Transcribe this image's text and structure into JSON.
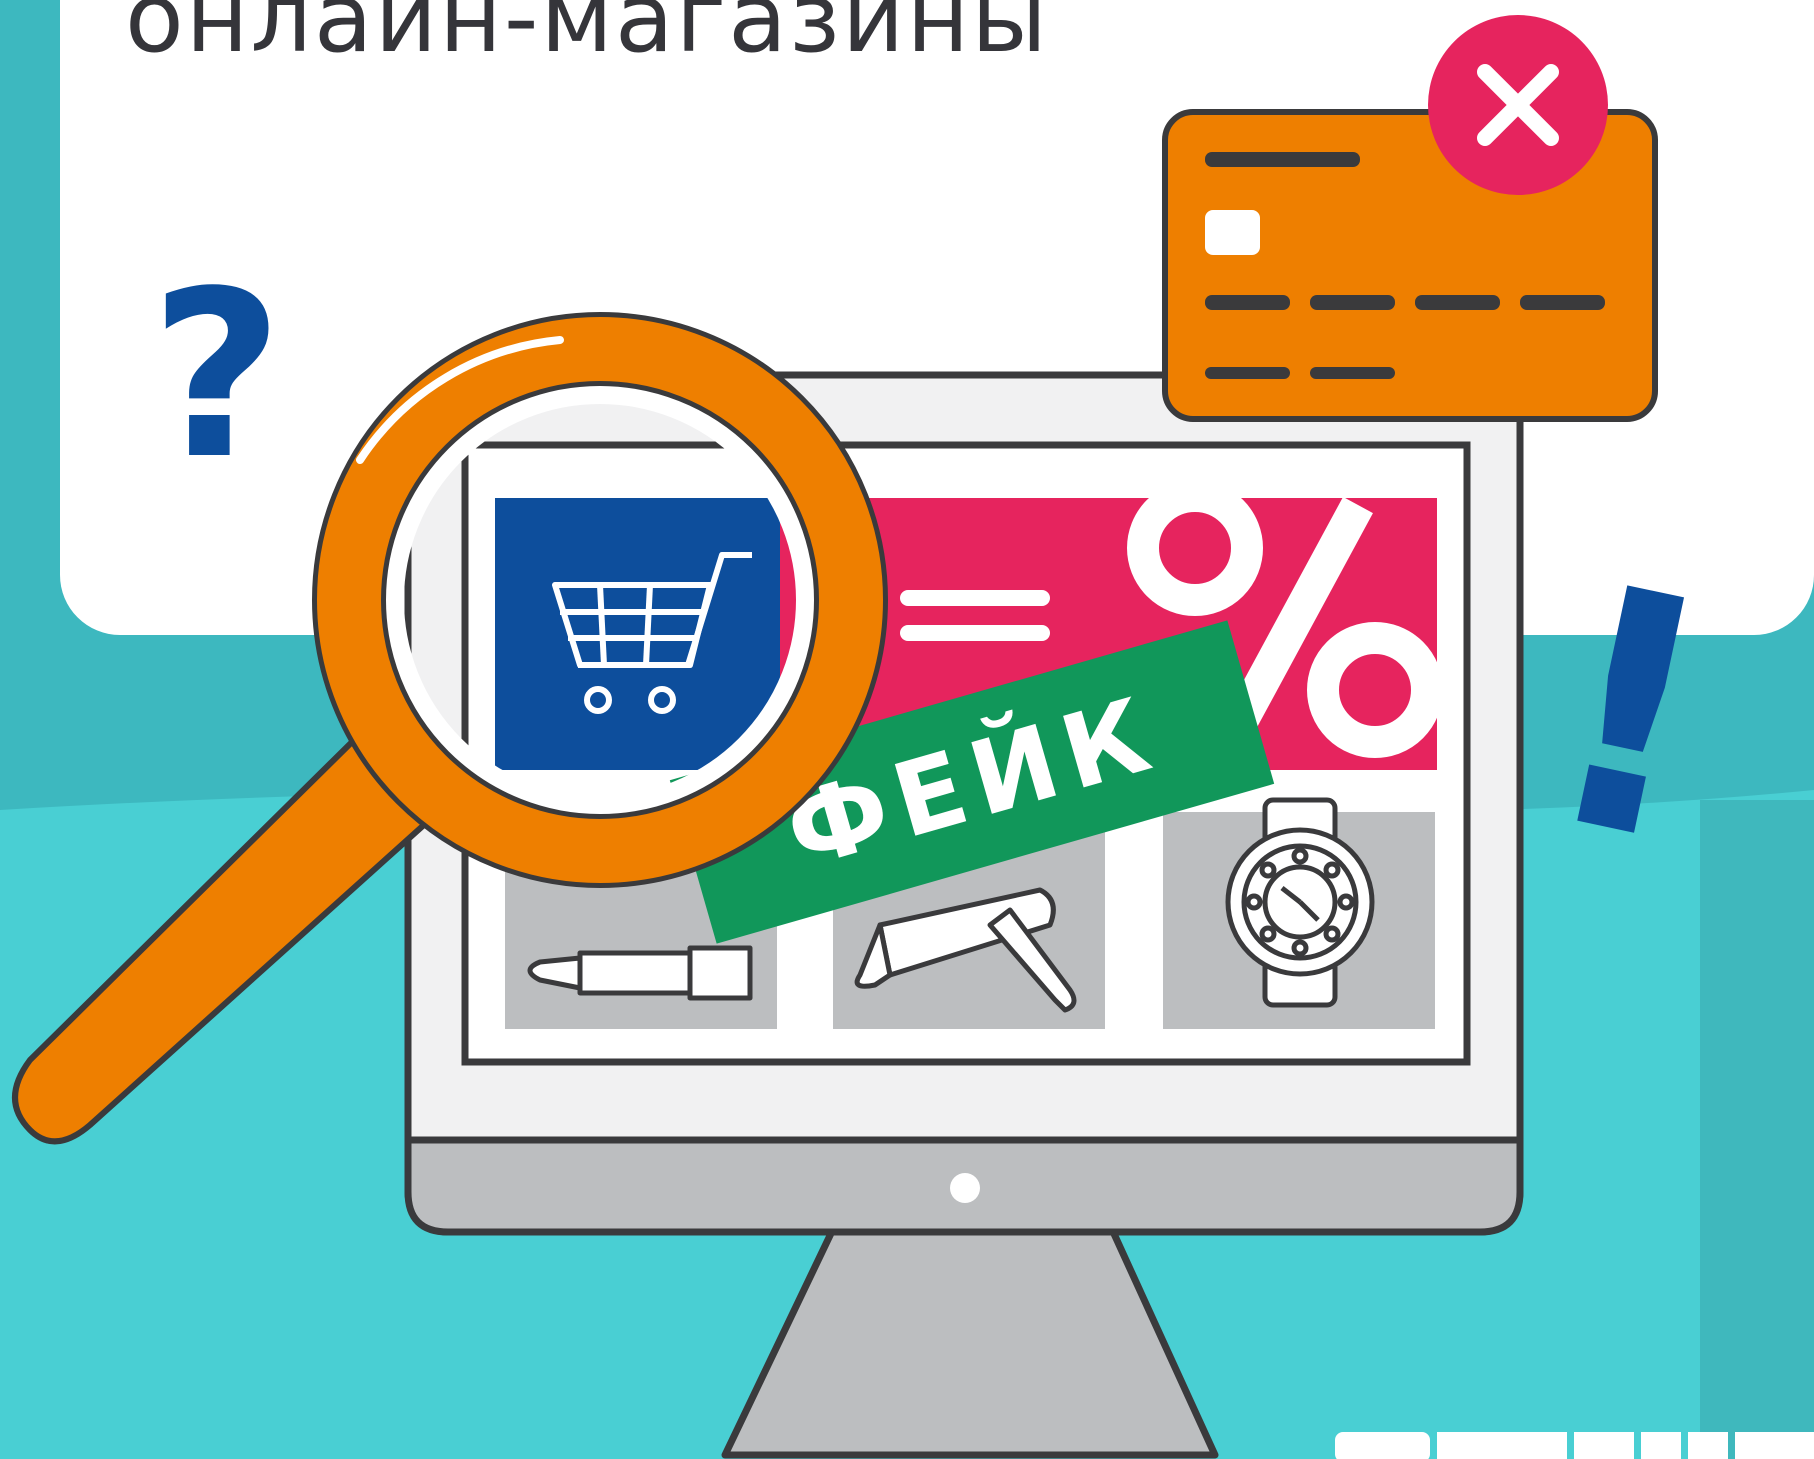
{
  "title": "онлайн-магазины",
  "stamp_text": "ФЕЙК",
  "symbols": {
    "question": "?",
    "exclamation": "!"
  },
  "icons": [
    "magnifier-icon",
    "shopping-cart-icon",
    "percent-icon",
    "credit-card-icon",
    "close-icon",
    "lipstick-icon",
    "hair-dryer-icon",
    "wristwatch-icon"
  ],
  "colors": {
    "background_teal": "#3db8bf",
    "light_teal": "#49cfd3",
    "panel_white": "#ffffff",
    "orange": "#ee7f00",
    "pink": "#e6245e",
    "blue": "#0d4e9c",
    "green": "#11975a",
    "monitor_gray": "#bcbec0",
    "outline": "#3a3a3c"
  }
}
